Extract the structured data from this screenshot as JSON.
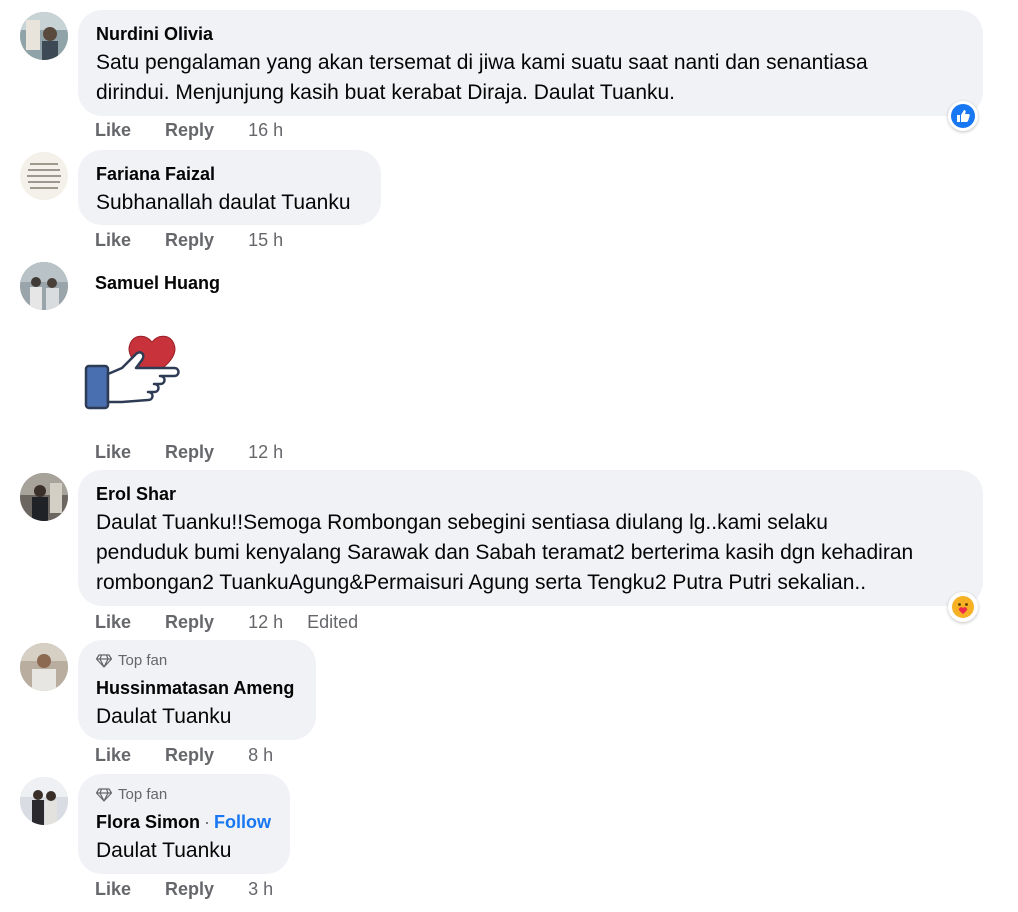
{
  "comments": [
    {
      "author": "Nurdini Olivia",
      "text_line1": "Satu pengalaman yang akan tersemat di jiwa kami suatu saat nanti dan senantiasa",
      "text_line2": "dirindui. Menjunjung kasih buat kerabat Diraja. Daulat Tuanku.",
      "like": "Like",
      "reply": "Reply",
      "time": "16 h",
      "reaction_icon": "like-reaction-icon"
    },
    {
      "author": "Fariana Faizal",
      "text": "Subhanallah daulat Tuanku",
      "like": "Like",
      "reply": "Reply",
      "time": "15 h"
    },
    {
      "author": "Samuel Huang",
      "sticker_icon": "hand-giving-heart-sticker",
      "like": "Like",
      "reply": "Reply",
      "time": "12 h"
    },
    {
      "author": "Erol Shar",
      "text_line1": "Daulat Tuanku!!Semoga Rombongan sebegini sentiasa diulang lg..kami selaku",
      "text_line2": "penduduk bumi kenyalang Sarawak dan Sabah teramat2 berterima kasih dgn kehadiran",
      "text_line3": "rombongan2 TuankuAgung&Permaisuri Agung serta Tengku2 Putra Putri sekalian..",
      "like": "Like",
      "reply": "Reply",
      "time": "12 h",
      "edited": "Edited",
      "reaction_icon": "care-reaction-icon"
    },
    {
      "badge": "Top fan",
      "author": "Hussinmatasan Ameng",
      "text": "Daulat Tuanku",
      "like": "Like",
      "reply": "Reply",
      "time": "8 h"
    },
    {
      "badge": "Top fan",
      "author": "Flora Simon",
      "separator": "·",
      "follow": "Follow",
      "text": "Daulat Tuanku",
      "like": "Like",
      "reply": "Reply",
      "time": "3 h"
    }
  ],
  "colors": {
    "bubble": "#f0f2f5",
    "meta": "#65676b",
    "link": "#1877f2",
    "like_blue": "#1877f2"
  }
}
